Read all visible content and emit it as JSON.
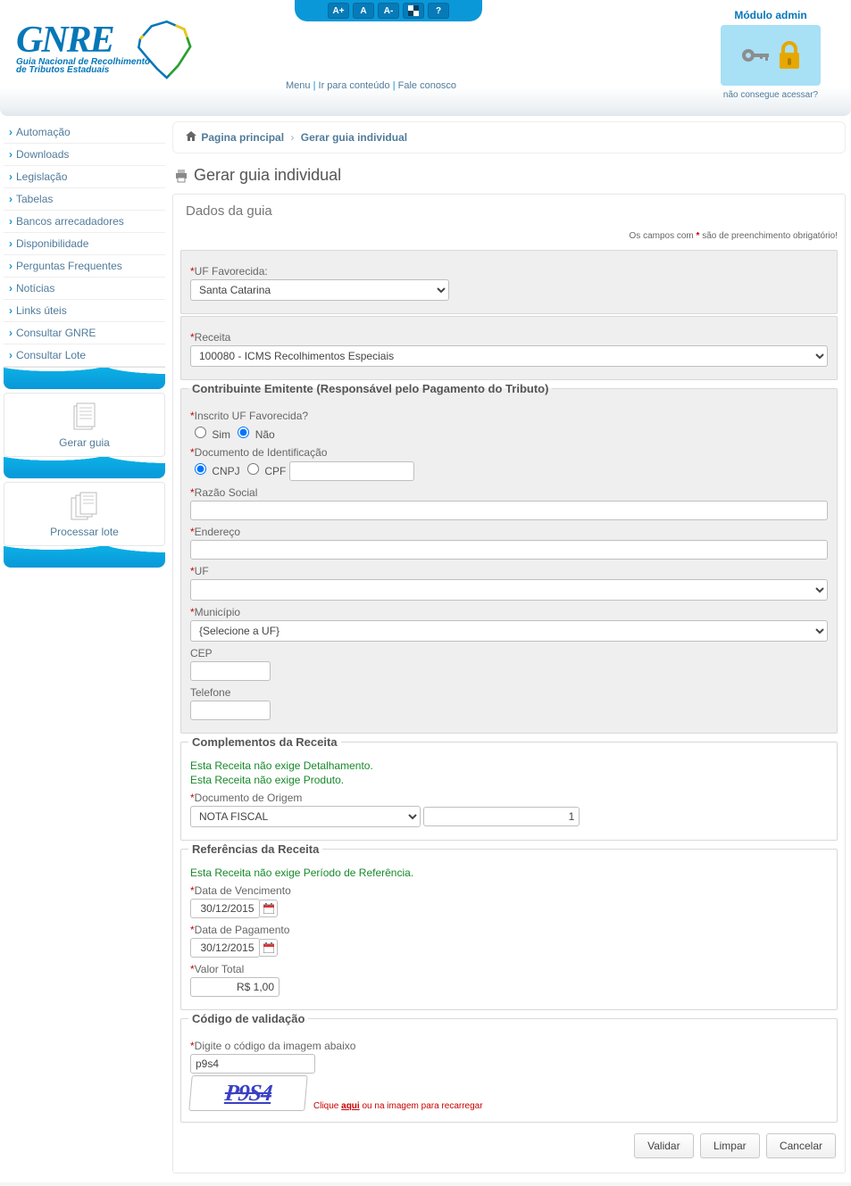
{
  "header": {
    "logo_title": "GNRE",
    "logo_sub1": "Guia Nacional de Recolhimento",
    "logo_sub2": "de Tributos Estaduais",
    "topbtns": {
      "aplus": "A+",
      "a": "A",
      "aminus": "A-",
      "help": "?"
    },
    "menu": {
      "menu": "Menu",
      "skip": "Ir para conteúdo",
      "contact": "Fale conosco"
    },
    "admin": {
      "title": "Módulo admin",
      "cant": "não consegue acessar?"
    }
  },
  "sidebar": {
    "items": [
      {
        "label": "Automação"
      },
      {
        "label": "Downloads"
      },
      {
        "label": "Legislação"
      },
      {
        "label": "Tabelas"
      },
      {
        "label": "Bancos arrecadadores"
      },
      {
        "label": "Disponibilidade"
      },
      {
        "label": "Perguntas Frequentes"
      },
      {
        "label": "Notícias"
      },
      {
        "label": "Links úteis"
      },
      {
        "label": "Consultar GNRE"
      },
      {
        "label": "Consultar Lote"
      }
    ],
    "gerar": "Gerar guia",
    "processar": "Processar lote"
  },
  "breadcrumb": {
    "home": "Pagina principal",
    "current": "Gerar guia individual"
  },
  "title": "Gerar guia individual",
  "panel": {
    "header": "Dados da guia",
    "required_note_pre": "Os campos com ",
    "required_note_post": " são de preenchimento obrigatório!"
  },
  "uf_favorecida": {
    "label": "UF Favorecida:",
    "selected": "Santa Catarina"
  },
  "receita": {
    "label": "Receita",
    "selected": "100080 - ICMS Recolhimentos Especiais"
  },
  "contribuinte": {
    "legend": "Contribuinte Emitente (Responsável pelo Pagamento do Tributo)",
    "inscrito_label": "Inscrito UF Favorecida?",
    "sim": "Sim",
    "nao": "Não",
    "doc_label": "Documento de Identificação",
    "cnpj": "CNPJ",
    "cpf": "CPF",
    "doc_value": "",
    "razao": "Razão Social",
    "endereco": "Endereço",
    "uf": "UF",
    "municipio_label": "Município",
    "municipio_selected": "{Selecione a UF}",
    "cep": "CEP",
    "telefone": "Telefone"
  },
  "complementos": {
    "legend": "Complementos da Receita",
    "n1": "Esta Receita não exige Detalhamento.",
    "n2": "Esta Receita não exige Produto.",
    "doc_origem_label": "Documento de Origem",
    "doc_origem_selected": "NOTA FISCAL",
    "doc_origem_num": "1"
  },
  "referencias": {
    "legend": "Referências da Receita",
    "n1": "Esta Receita não exige Período de Referência.",
    "venc_label": "Data de Vencimento",
    "venc_val": "30/12/2015",
    "pag_label": "Data de Pagamento",
    "pag_val": "30/12/2015",
    "valor_label": "Valor Total",
    "valor_val": "R$ 1,00"
  },
  "captcha": {
    "legend": "Código de validação",
    "label": "Digite o código da imagem abaixo",
    "input": "p9s4",
    "img_text": "P9S4",
    "note_pre": "Clique ",
    "note_link": "aqui",
    "note_post": " ou na imagem para recarregar"
  },
  "buttons": {
    "validar": "Validar",
    "limpar": "Limpar",
    "cancelar": "Cancelar"
  }
}
